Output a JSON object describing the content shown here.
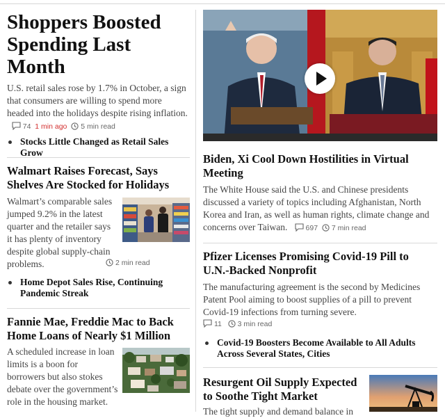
{
  "articles": {
    "lead": {
      "headline": "Shoppers Boosted Spending Last Month",
      "summary": "U.S. retail sales rose by 1.7% in October, a sign that consumers are willing to spend more headed into the holidays despite rising inflation.",
      "comments": "74",
      "time_ago": "1 min ago",
      "read_time": "5 min read",
      "related": "Stocks Little Changed as Retail Sales Grow"
    },
    "walmart": {
      "headline": "Walmart Raises Forecast, Says Shelves Are Stocked for Holidays",
      "summary": "Walmart’s comparable sales jumped 9.2% in the latest quarter and the retailer says it has plenty of inventory despite global supply-chain problems.",
      "read_time": "2 min read",
      "related": "Home Depot Sales Rise, Continuing Pandemic Streak"
    },
    "fannie": {
      "headline": "Fannie Mae, Freddie Mac to Back Home Loans of Nearly $1 Million",
      "summary": "A scheduled increase in loan limits is a boon for borrowers but also stokes debate over the government’s role in the housing market."
    },
    "biden": {
      "headline": "Biden, Xi Cool Down Hostilities in Virtual Meeting",
      "summary": "The White House said the U.S. and Chinese presidents discussed a variety of topics including Afghanistan, North Korea and Iran, as well as human rights, climate change and concerns over Taiwan.",
      "comments": "697",
      "read_time": "7 min read"
    },
    "pfizer": {
      "headline": "Pfizer Licenses Promising Covid-19 Pill to U.N.-Backed Nonprofit",
      "summary": "The manufacturing agreement is the second by Medicines Patent Pool aiming to boost supplies of a pill to prevent Covid-19 infections from turning severe.",
      "comments": "11",
      "read_time": "3 min read",
      "related": "Covid-19 Boosters Become Available to All Adults Across Several States, Cities"
    },
    "oil": {
      "headline": "Resurgent Oil Supply Expected to Soothe Tight Market",
      "summary": "The tight supply and demand balance in"
    }
  },
  "icons": {
    "comment": "speech-bubble-icon",
    "clock": "clock-icon",
    "play": "play-icon"
  },
  "colors": {
    "timestamp": "#d32f2f",
    "meta": "#666666",
    "divider": "#d8d8d8"
  }
}
